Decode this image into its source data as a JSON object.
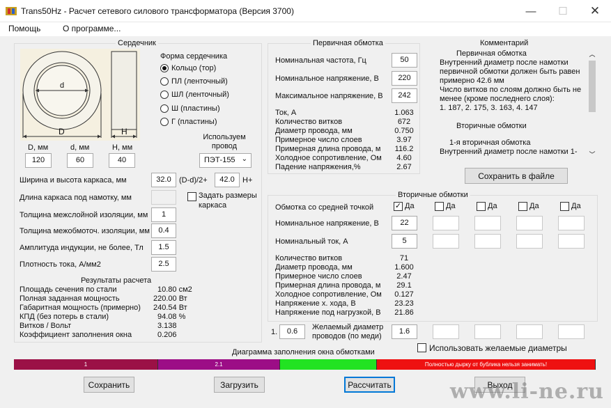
{
  "window": {
    "title": "Trans50Hz - Расчет сетевого силового трансформатора (Версия 3700)"
  },
  "menu": [
    "Помощь",
    "О программе..."
  ],
  "core": {
    "title": "Сердечник",
    "dim_labels": {
      "D": "D",
      "d": "d",
      "H": "H"
    },
    "params": [
      {
        "label": "D, мм",
        "value": "120"
      },
      {
        "label": "d, мм",
        "value": "60"
      },
      {
        "label": "H, мм",
        "value": "40"
      }
    ],
    "shape_title": "Форма сердечника",
    "shapes": [
      {
        "label": "Кольцо  (тор)",
        "selected": true
      },
      {
        "label": "ПЛ  (ленточный)",
        "selected": false
      },
      {
        "label": "ШЛ  (ленточный)",
        "selected": false
      },
      {
        "label": "Ш  (пластины)",
        "selected": false
      },
      {
        "label": "Г (пластины)",
        "selected": false
      }
    ],
    "wire_title": "Используем провод",
    "wire_value": "ПЭТ-155",
    "fields": [
      {
        "label": "Ширина и высота каркаса, мм",
        "value": "32.0"
      },
      {
        "label": "Длина каркаса под намотку, мм",
        "value": ""
      },
      {
        "label": "Толщина межслойной изоляции, мм",
        "value": "1"
      },
      {
        "label": "Толщина межобмоточ. изоляции, мм",
        "value": "0.4"
      },
      {
        "label": "Амплитуда индукции, не более, Тл",
        "value": "1.5"
      },
      {
        "label": "Плотность тока, А/мм2",
        "value": "2.5"
      }
    ],
    "formula_label": "(D-d)/2+",
    "formula_value": "42.0",
    "formula_suffix": "H+",
    "set_sizes_label": "Задать размеры каркаса",
    "results_title": "Результаты расчета",
    "results": [
      {
        "label": "Площадь сечения по стали",
        "value": "10.80 см2"
      },
      {
        "label": "Полная заданная мощность",
        "value": "220.00 Вт"
      },
      {
        "label": "Габаритная мощность (примерно)",
        "value": "240.54 Вт"
      },
      {
        "label": "КПД (без потерь в стали)",
        "value": "94.08 %"
      },
      {
        "label": "Витков / Вольт",
        "value": "3.138"
      },
      {
        "label": "Коэффициент заполнения окна",
        "value": "0.206"
      }
    ]
  },
  "primary": {
    "title": "Первичная обмотка",
    "inputs": [
      {
        "label": "Номинальная частота, Гц",
        "value": "50"
      },
      {
        "label": "Номинальное напряжение, В",
        "value": "220"
      },
      {
        "label": "Максимальное напряжение, В",
        "value": "242"
      }
    ],
    "results": [
      {
        "label": "Ток, А",
        "value": "1.063"
      },
      {
        "label": "Количество витков",
        "value": "672"
      },
      {
        "label": "Диаметр провода, мм",
        "value": "0.750"
      },
      {
        "label": "Примерное число слоев",
        "value": "3.97"
      },
      {
        "label": "Примерная длина провода, м",
        "value": "116.2"
      },
      {
        "label": "Холодное сопротивление, Ом",
        "value": "4.60"
      },
      {
        "label": "Падение напряжения,%",
        "value": "2.67"
      }
    ]
  },
  "comment": {
    "title": "Комментарий",
    "lines": [
      "Первичная обмотка",
      "Внутренний диаметр после намотки",
      "первичной обмотки должен быть равен",
      "примерно 42.6 мм",
      "Число витков по слоям должно быть не",
      "менее (кроме последнего слоя):",
      "1. 187, 2. 175, 3. 163, 4. 147",
      "",
      "Вторичные обмотки",
      "",
      "1-я вторичная обмотка",
      "Внутренний диаметр после намотки 1-"
    ],
    "save_button": "Сохранить в файле"
  },
  "secondary": {
    "title": "Вторичные обмотки",
    "center_tap_label": "Обмотка со средней точкой",
    "yes_label": "Да",
    "center_tap": [
      true,
      false,
      false,
      false,
      false
    ],
    "voltage_label": "Номинальное напряжение, В",
    "voltages": [
      "22",
      "",
      "",
      "",
      ""
    ],
    "current_label": "Номинальный ток, А",
    "currents": [
      "5",
      "",
      "",
      "",
      ""
    ],
    "results": [
      {
        "label": "Количество витков",
        "value": "71"
      },
      {
        "label": "Диаметр провода, мм",
        "value": "1.600"
      },
      {
        "label": "Примерное число слоев",
        "value": "2.47"
      },
      {
        "label": "Примерная длина провода, м",
        "value": "29.1"
      },
      {
        "label": "Холодное сопротивление, Ом",
        "value": "0.127"
      },
      {
        "label": "Напряжение х. хода, В",
        "value": "23.23"
      },
      {
        "label": "Напряжение под нагрузкой, В",
        "value": "21.86"
      }
    ],
    "desired_prefix": "1.",
    "desired_primary": "0.6",
    "desired_label": "Желаемый диаметр проводов  (по меди)",
    "desired": [
      "1.6",
      "",
      "",
      "",
      ""
    ],
    "use_desired_label": "Использовать желаемые диаметры"
  },
  "diagram": {
    "title": "Диаграмма заполнения окна обмотками",
    "segments": [
      {
        "label": "1",
        "color": "#9b1146",
        "fraction": 0.2485
      },
      {
        "label": "2.1",
        "color": "#9c0d86",
        "fraction": 0.2101
      },
      {
        "label": "",
        "color": "#22e322",
        "fraction": 0.1662
      },
      {
        "label": "Полностью дырку от бублика нельзя занимать!",
        "color": "#ee1111",
        "fraction": 0.3752
      }
    ]
  },
  "buttons": {
    "save": "Сохранить",
    "load": "Загрузить",
    "calc": "Рассчитать",
    "exit": "Выход"
  },
  "watermark": "www.li-ne.ru"
}
